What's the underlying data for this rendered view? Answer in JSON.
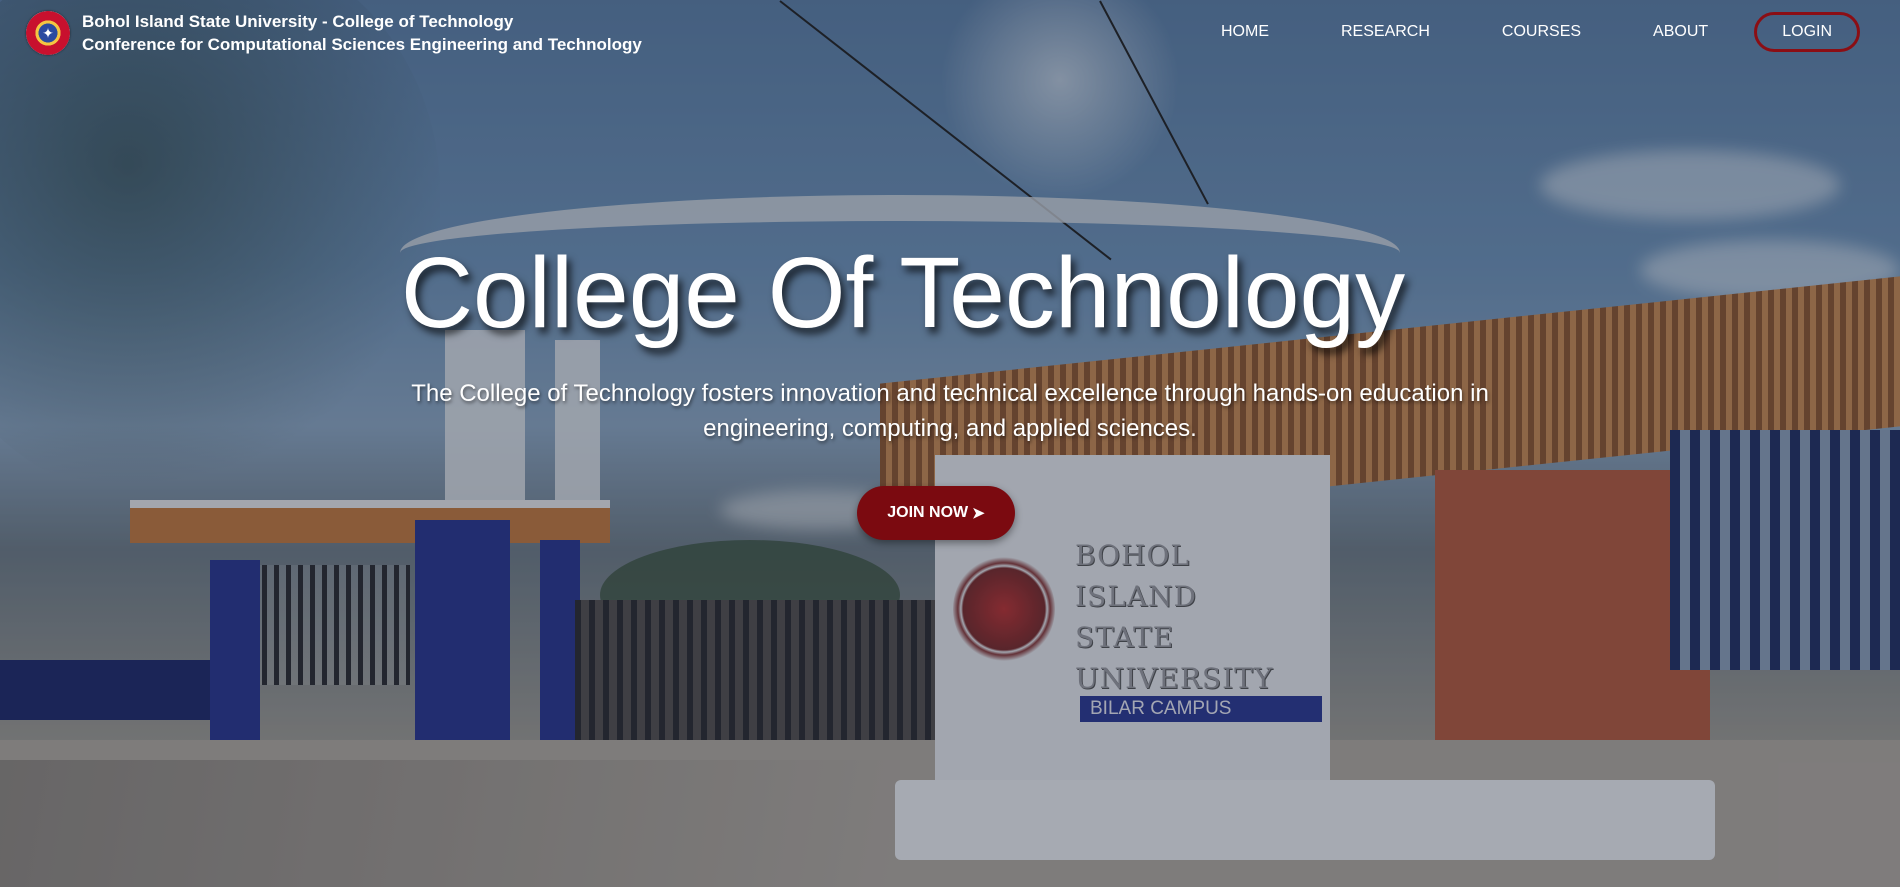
{
  "brand": {
    "logo_icon": "university-seal-icon",
    "line1": "Bohol Island State University - College of Technology",
    "line2": "Conference for Computational Sciences Engineering and Technology"
  },
  "nav": {
    "items": [
      "HOME",
      "RESEARCH",
      "COURSES",
      "ABOUT"
    ],
    "login_label": "LOGIN"
  },
  "hero": {
    "title": "College Of Technology",
    "subtitle_line1": "The College of Technology fosters innovation and technical excellence through hands-on education in",
    "subtitle_line2": "engineering, computing, and applied sciences.",
    "cta_label": "JOIN NOW",
    "cta_icon": "chevron-right-icon"
  },
  "background": {
    "sign_lines": [
      "BOHOL",
      "ISLAND",
      "STATE",
      "UNIVERSITY"
    ],
    "sign_banner": "BILAR CAMPUS"
  },
  "colors": {
    "accent": "#7b0a10",
    "login_border": "#8b0e14",
    "text": "#ffffff"
  }
}
